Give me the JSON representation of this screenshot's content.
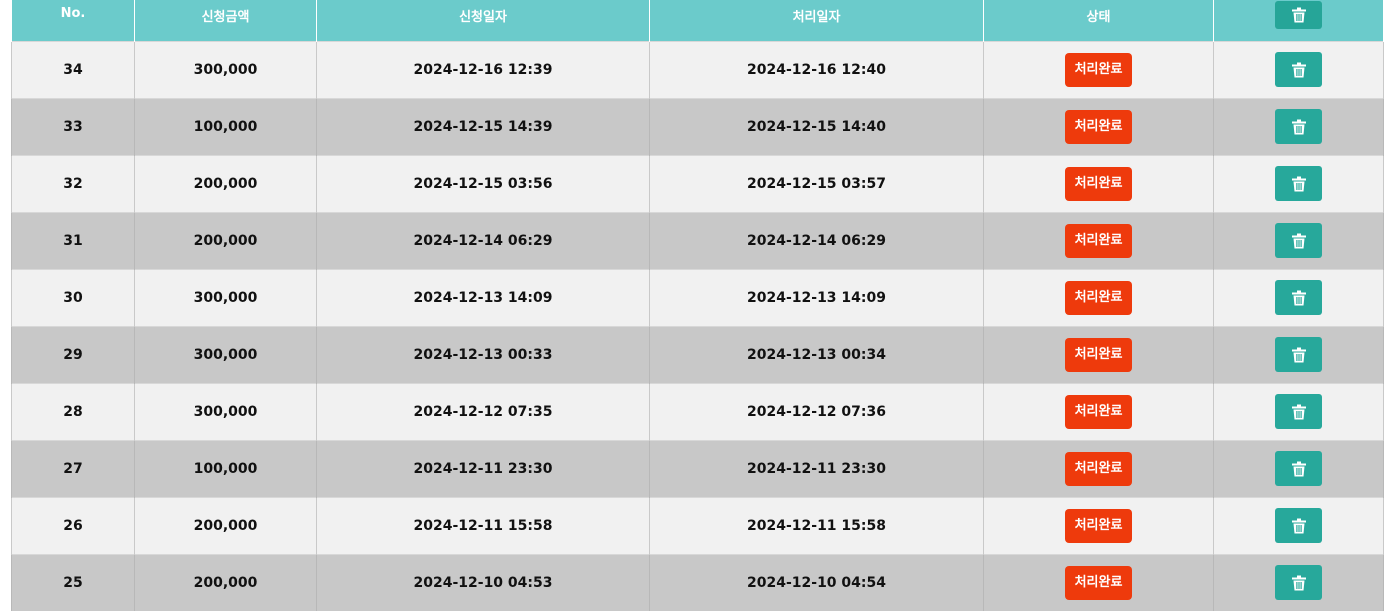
{
  "table": {
    "headers": {
      "no": "No.",
      "amount": "신청금액",
      "requested": "신청일자",
      "processed": "처리일자",
      "status": "상태"
    },
    "status_label": "처리완료",
    "delete_icon": "trash-icon",
    "rows": [
      {
        "no": "34",
        "amount": "300,000",
        "requested": "2024-12-16 12:39",
        "processed": "2024-12-16 12:40",
        "status": "처리완료"
      },
      {
        "no": "33",
        "amount": "100,000",
        "requested": "2024-12-15 14:39",
        "processed": "2024-12-15 14:40",
        "status": "처리완료"
      },
      {
        "no": "32",
        "amount": "200,000",
        "requested": "2024-12-15 03:56",
        "processed": "2024-12-15 03:57",
        "status": "처리완료"
      },
      {
        "no": "31",
        "amount": "200,000",
        "requested": "2024-12-14 06:29",
        "processed": "2024-12-14 06:29",
        "status": "처리완료"
      },
      {
        "no": "30",
        "amount": "300,000",
        "requested": "2024-12-13 14:09",
        "processed": "2024-12-13 14:09",
        "status": "처리완료"
      },
      {
        "no": "29",
        "amount": "300,000",
        "requested": "2024-12-13 00:33",
        "processed": "2024-12-13 00:34",
        "status": "처리완료"
      },
      {
        "no": "28",
        "amount": "300,000",
        "requested": "2024-12-12 07:35",
        "processed": "2024-12-12 07:36",
        "status": "처리완료"
      },
      {
        "no": "27",
        "amount": "100,000",
        "requested": "2024-12-11 23:30",
        "processed": "2024-12-11 23:30",
        "status": "처리완료"
      },
      {
        "no": "26",
        "amount": "200,000",
        "requested": "2024-12-11 15:58",
        "processed": "2024-12-11 15:58",
        "status": "처리완료"
      },
      {
        "no": "25",
        "amount": "200,000",
        "requested": "2024-12-10 04:53",
        "processed": "2024-12-10 04:54",
        "status": "처리완료"
      }
    ]
  },
  "colors": {
    "header_bg": "#6bcbcb",
    "row_light": "#f1f1f1",
    "row_dark": "#c8c8c8",
    "status_badge": "#ee3a0c",
    "delete_button": "#27a89b"
  }
}
